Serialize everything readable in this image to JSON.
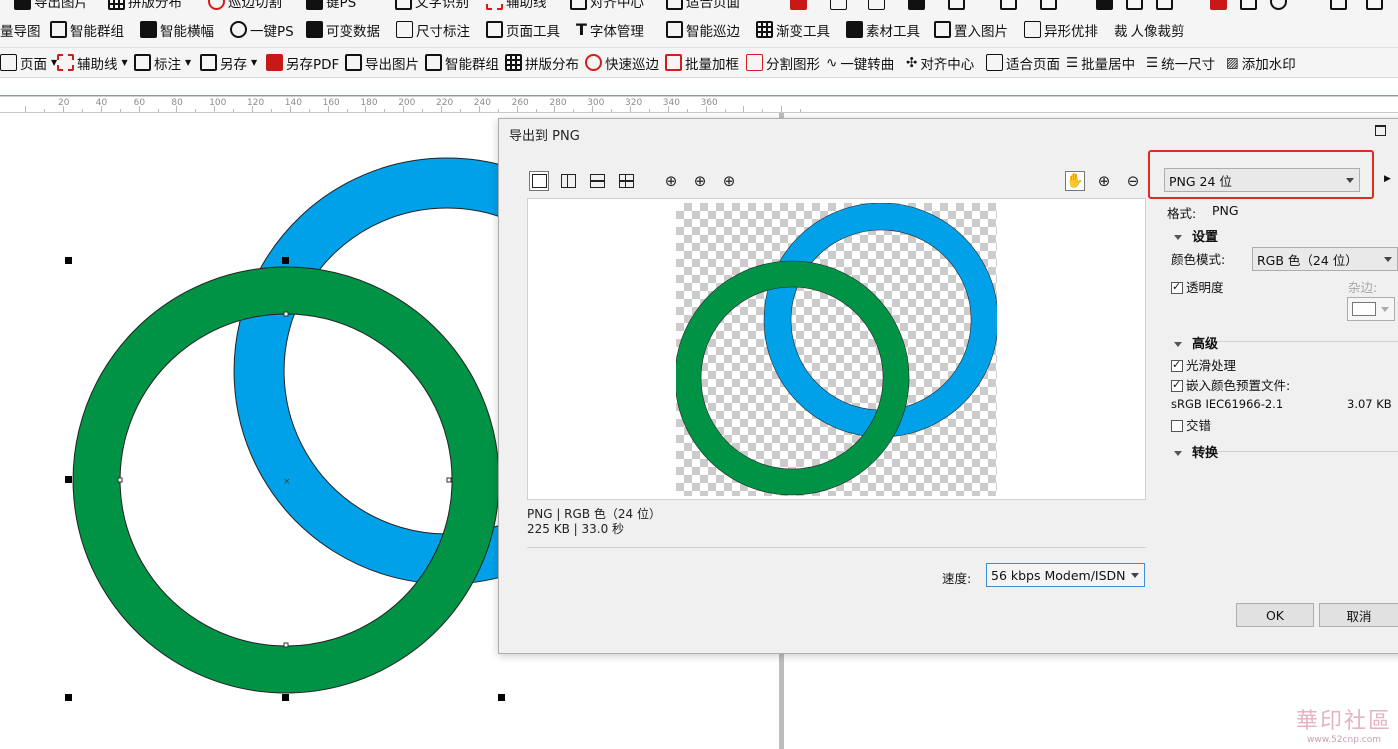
{
  "toolbar_top_partial": [
    "导出图片",
    "拼版分布",
    "巡边切割",
    "键PS",
    "文字识别",
    "辅助线",
    "对齐中心",
    "适合页面"
  ],
  "toolbar1": [
    "量导图",
    "智能群组",
    "智能横幅",
    "一键PS",
    "可变数据",
    "尺寸标注",
    "页面工具",
    "字体管理",
    "智能巡边",
    "渐变工具",
    "素材工具",
    "置入图片",
    "异形优排",
    "人像裁剪"
  ],
  "toolbar2": [
    "页面",
    "辅助线",
    "标注",
    "另存",
    "另存PDF",
    "导出图片",
    "智能群组",
    "拼版分布",
    "快速巡边",
    "批量加框",
    "分割图形",
    "一键转曲",
    "对齐中心",
    "适合页面",
    "批量居中",
    "统一尺寸",
    "添加水印"
  ],
  "ruler_labels": [
    "20",
    "40",
    "60",
    "80",
    "100",
    "120",
    "140",
    "160",
    "180",
    "200",
    "220",
    "240",
    "260",
    "280",
    "300",
    "320",
    "340",
    "360"
  ],
  "colors": {
    "blue_ring": "#00a1e9",
    "green_ring": "#009245",
    "highlight": "#e02b20"
  },
  "dialog": {
    "title": "导出到 PNG",
    "format_select": "PNG 24 位",
    "format_label": "格式:",
    "format_value": "PNG",
    "settings_header": "设置",
    "color_mode_label": "颜色模式:",
    "color_mode_value": "RGB 色（24 位）",
    "transparency_label": "透明度",
    "transparency_checked": true,
    "matte_label": "杂边:",
    "advanced_header": "高级",
    "smoothing_label": "光滑处理",
    "smoothing_checked": true,
    "embed_profile_label": "嵌入颜色预置文件:",
    "embed_profile_checked": true,
    "profile_name": "sRGB IEC61966-2.1",
    "profile_size": "3.07 KB",
    "interlace_label": "交错",
    "interlace_checked": false,
    "convert_header": "转换",
    "preview_info_line1": "PNG | RGB 色（24 位）",
    "preview_info_line2": "225 KB | 33.0 秒",
    "speed_label": "速度:",
    "speed_value": "56 kbps Modem/ISDN",
    "ok_label": "OK",
    "cancel_label": "取消"
  },
  "watermark": {
    "line1": "華印社區",
    "line2": "www.52cnp.com"
  }
}
